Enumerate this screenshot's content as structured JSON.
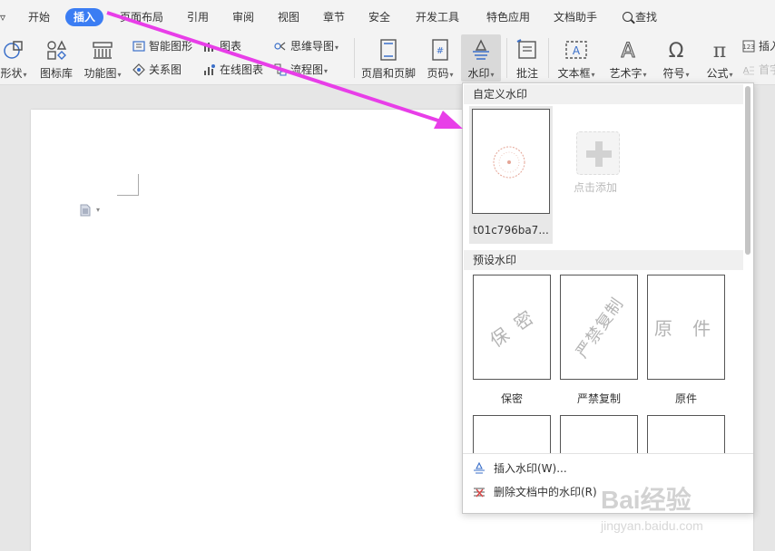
{
  "menu": {
    "items": [
      "开始",
      "插入",
      "页面布局",
      "引用",
      "审阅",
      "视图",
      "章节",
      "安全",
      "开发工具",
      "特色应用",
      "文档助手"
    ],
    "search_label": "查找",
    "active": "插入"
  },
  "toolbar": {
    "shapes": "形状",
    "icon_library": "图标库",
    "function_chart": "功能图",
    "smart_graphic": "智能图形",
    "chart": "图表",
    "mind_map": "思维导图",
    "relation_chart": "关系图",
    "online_chart": "在线图表",
    "flowchart": "流程图",
    "header_footer": "页眉和页脚",
    "page_number": "页码",
    "watermark": "水印",
    "comment": "批注",
    "text_box": "文本框",
    "word_art": "艺术字",
    "symbol": "符号",
    "formula": "公式",
    "insert_number": "插入",
    "first_letter": "首字"
  },
  "dropdown": {
    "custom_header": "自定义水印",
    "custom_item_name": "t01c796ba7...",
    "add_label": "点击添加",
    "preset_header": "预设水印",
    "presets": [
      {
        "caption": "保密",
        "text": "保 密"
      },
      {
        "caption": "严禁复制",
        "text": "严禁复制"
      },
      {
        "caption": "原件",
        "text": "原 件"
      }
    ],
    "insert_watermark": "插入水印(W)...",
    "delete_watermark": "删除文档中的水印(R)"
  },
  "colors": {
    "active_tab": "#3b7df3",
    "annotation_arrow": "#e83ee8"
  },
  "logo": {
    "brand": "Bai经验",
    "url_text": "jingyan.baidu.com"
  }
}
